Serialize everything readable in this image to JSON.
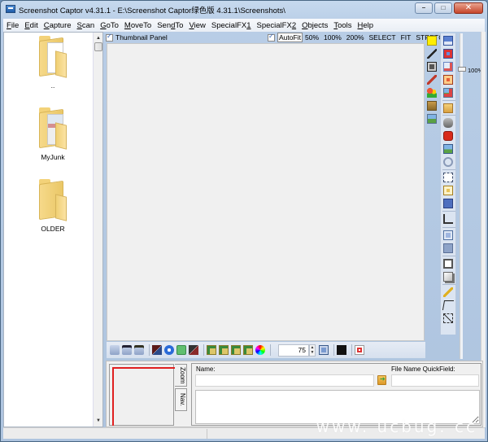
{
  "window": {
    "title": "Screenshot Captor v4.31.1 - E:\\Screenshot Captor绿色版 4.31.1\\Screenshots\\",
    "buttons": {
      "minimize": "–",
      "maximize": "□",
      "close": "✕"
    }
  },
  "menubar": {
    "items": [
      {
        "pre": "",
        "key": "F",
        "post": "ile"
      },
      {
        "pre": "",
        "key": "E",
        "post": "dit"
      },
      {
        "pre": "",
        "key": "C",
        "post": "apture"
      },
      {
        "pre": "",
        "key": "S",
        "post": "can"
      },
      {
        "pre": "",
        "key": "G",
        "post": "oTo"
      },
      {
        "pre": "",
        "key": "M",
        "post": "oveTo"
      },
      {
        "pre": "Sen",
        "key": "d",
        "post": "To"
      },
      {
        "pre": "",
        "key": "V",
        "post": "iew"
      },
      {
        "pre": "SpecialFX",
        "key": "1",
        "post": ""
      },
      {
        "pre": "SpecialFX",
        "key": "2",
        "post": ""
      },
      {
        "pre": "",
        "key": "O",
        "post": "bjects"
      },
      {
        "pre": "",
        "key": "T",
        "post": "ools"
      },
      {
        "pre": "",
        "key": "H",
        "post": "elp"
      }
    ]
  },
  "file_panel": {
    "folders": [
      {
        "label": "..",
        "icon": "parent-folder-icon",
        "kind": "papers"
      },
      {
        "label": "MyJunk",
        "icon": "folder-with-screenshot-icon",
        "kind": "screen"
      },
      {
        "label": "OLDER",
        "icon": "folder-icon",
        "kind": "empty"
      }
    ]
  },
  "viewer": {
    "thumbnail_panel_label": "Thumbnail Panel",
    "thumbnail_panel_checked": true,
    "autofit_label": "AutoFit",
    "autofit_checked": true,
    "zoom_links": [
      "50%",
      "100%",
      "200%",
      "SELECT",
      "FIT",
      "STRETCH"
    ],
    "zoom_level": "100%"
  },
  "right_toolbar": {
    "col1": [
      "color-swatch-icon",
      "pen-arrow-icon",
      "lock-image-icon",
      "brush-icon",
      "shapes-icon",
      "image-stack-icon",
      "landscape-image-icon"
    ],
    "col2": [
      "save-icon",
      "delete-icon",
      "edit-icon",
      "text-icon",
      "crop-image-icon",
      "move-image-icon",
      "print-icon",
      "toolbox-icon",
      "screen-capture-icon",
      "link-icon",
      "select-region-icon",
      "resize-icon",
      "shadow-image-icon",
      "crop-icon",
      "frame-icon",
      "frame-dark-icon",
      "border-icon",
      "shadow-box-icon",
      "magic-wand-icon",
      "pointer-icon",
      "select-all-icon"
    ]
  },
  "bottom_toolbar": {
    "icons_a": [
      "scanner-icon",
      "scanner-text-icon",
      "scanner-ocr-icon"
    ],
    "icons_b": [
      "flip-icon",
      "rotate-icon",
      "green-square-icon",
      "mirror-icon"
    ],
    "icons_c": [
      "thumb-1-icon",
      "thumb-2-icon",
      "thumb-3-icon",
      "thumb-4-icon",
      "color-wheel-icon"
    ],
    "quality_value": "75",
    "icons_d": [
      "jpeg-icon",
      "cursor-icon",
      "pdf-icon"
    ]
  },
  "bottom_panel": {
    "tabs": [
      "Zoom",
      "Nav."
    ],
    "name_label": "Name:",
    "name_value": "",
    "quickfield_label": "File Name QuickField:",
    "quickfield_value": "",
    "comment_value": ""
  },
  "watermark": "www. ucbug. cc",
  "colors": {
    "nav_viewport": "#e02020",
    "accent": "#2b5db3"
  }
}
